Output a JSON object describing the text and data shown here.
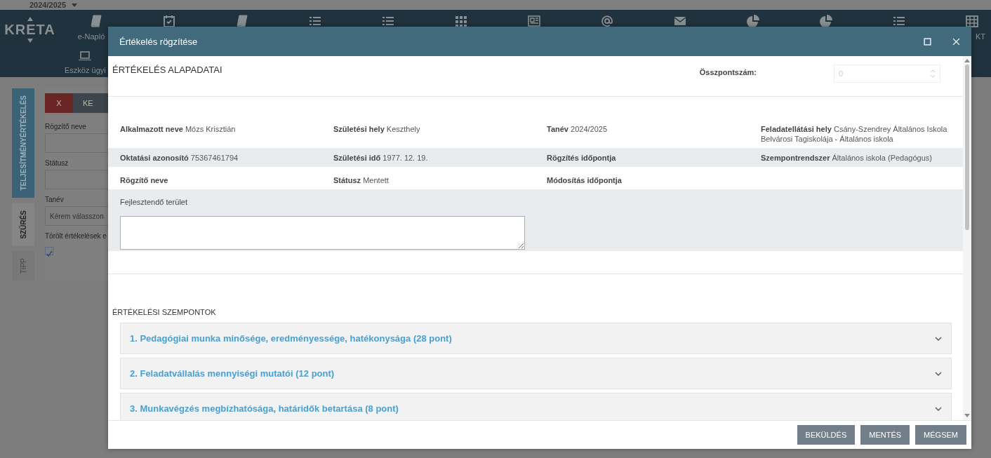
{
  "top_bar": {
    "school_year": "2024/2025"
  },
  "nav": {
    "logo": "KRETA",
    "items": [
      {
        "kind": "book",
        "label": "e-Napló"
      },
      {
        "kind": "calendar"
      },
      {
        "kind": "book"
      },
      {
        "kind": "list"
      },
      {
        "kind": "list"
      },
      {
        "kind": "grid"
      },
      {
        "kind": "newspaper"
      },
      {
        "kind": "at"
      },
      {
        "kind": "envelope"
      },
      {
        "kind": "pie"
      },
      {
        "kind": "pie"
      },
      {
        "kind": "list"
      },
      {
        "kind": "table",
        "label": "KT"
      }
    ],
    "second_row": [
      {
        "kind": "laptop",
        "label": "Eszköz ügyi"
      }
    ]
  },
  "side_tabs": [
    {
      "label": "TELJESÍTMÉNYÉRTÉKELÉS",
      "selected": true,
      "disabled": false
    },
    {
      "label": "SZŰRÉS",
      "selected": false,
      "disabled": false
    },
    {
      "label": "TIPP",
      "selected": false,
      "disabled": true
    }
  ],
  "filter": {
    "buttons": [
      {
        "label": "X",
        "kind": "clear"
      },
      {
        "label": "KE",
        "kind": "search"
      }
    ],
    "fields": [
      {
        "label": "Rögzítő neve",
        "kind": "text"
      },
      {
        "label": "Státusz",
        "kind": "text"
      },
      {
        "label": "Tanév",
        "kind": "select",
        "placeholder": "Kérem válasszon"
      }
    ],
    "checkbox": {
      "label": "Törölt értékelések e",
      "checked": true
    }
  },
  "modal": {
    "title": "Értékelés rögzítése",
    "section_title": "ÉRTÉKELÉS ALAPADATAI",
    "total": {
      "label": "Összpontszám:",
      "value": "0",
      "disabled": true
    },
    "info_rows": [
      [
        {
          "label": "Alkalmazott neve",
          "value": "Mózs Krisztián"
        },
        {
          "label": "Születési hely",
          "value": "Keszthely"
        },
        {
          "label": "Tanév",
          "value": "2024/2025"
        },
        {
          "label": "Feladatellátási hely",
          "value": "Csány-Szendrey Általános Iskola Belvárosi Tagiskolája - Általános iskola"
        }
      ],
      [
        {
          "label": "Oktatási azonosító",
          "value": "75367461794"
        },
        {
          "label": "Születési idő",
          "value": "1977. 12. 19."
        },
        {
          "label": "Rögzítés időpontja"
        },
        {
          "label": "Szempontrendszer",
          "value": "Általános iskola (Pedagógus)"
        }
      ],
      [
        {
          "label": "Rögzítő neve"
        },
        {
          "label": "Státusz",
          "value": "Mentett"
        },
        {
          "label": "Módosítás időpontja"
        }
      ]
    ],
    "development": {
      "label": "Fejlesztendő terület"
    },
    "criteria_title": "ÉRTÉKELÉSI SZEMPONTOK",
    "criteria": [
      {
        "label": "1. Pedagógiai munka minősége, eredményessége, hatékonysága (28 pont)",
        "expanded": false
      },
      {
        "label": "2. Feladatvállalás mennyiségi mutatói (12 pont)",
        "expanded": false
      },
      {
        "label": "3. Munkavégzés megbízhatósága, határidők betartása (8 pont)",
        "expanded": false
      }
    ],
    "buttons": [
      "BEKÜLDÉS",
      "MENTÉS",
      "MÉGSEM"
    ]
  }
}
